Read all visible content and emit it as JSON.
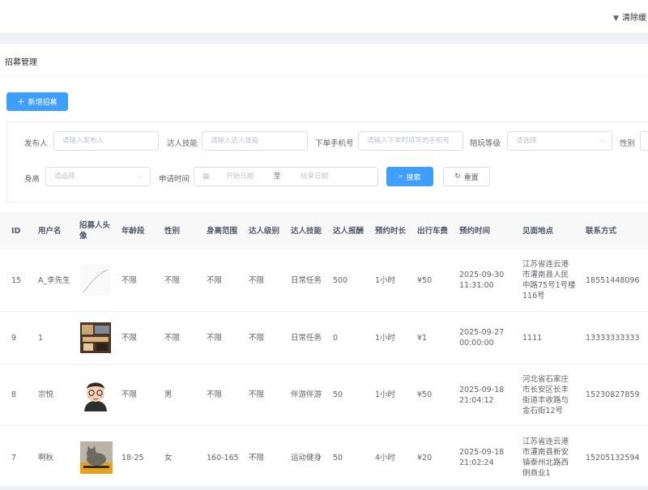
{
  "header": {
    "clear_label": "清除缓"
  },
  "page": {
    "title": "招募管理",
    "add_button": "新增招募"
  },
  "filters": {
    "publisher": {
      "label": "发布人",
      "placeholder": "请输入发布人"
    },
    "talent_skill": {
      "label": "达人技能",
      "placeholder": "请输入达人技能"
    },
    "phone": {
      "label": "下单手机号",
      "placeholder": "请输入下单时填写的手机号"
    },
    "play_level": {
      "label": "陪玩等级",
      "placeholder": "请选择"
    },
    "gender": {
      "label": "性别"
    },
    "height": {
      "label": "身高",
      "placeholder": "请选择"
    },
    "apply_time": {
      "label": "申请时间",
      "start": "开始日期",
      "sep": "至",
      "end": "结束日期"
    },
    "search_button": "搜索",
    "reset_button": "重置"
  },
  "table": {
    "headers": [
      "ID",
      "用户名",
      "招募人头像",
      "年龄段",
      "性别",
      "身高范围",
      "达人级别",
      "达人技能",
      "达人报酬",
      "预约时长",
      "出行车费",
      "预约时间",
      "见面地点",
      "联系方式"
    ],
    "rows": [
      {
        "id": "15",
        "username": "A_李先生",
        "avatar": "sketch",
        "age": "不限",
        "gender": "不限",
        "height": "不限",
        "level": "不限",
        "skill": "日常任务",
        "reward": "500",
        "duration": "1小时",
        "fare": "¥50",
        "time": "2025-09-30 11:31:00",
        "location": "江苏省连云港市灌南县人民中路75号1号楼116号",
        "contact": "18551448096"
      },
      {
        "id": "9",
        "username": "1",
        "avatar": "photo-dark",
        "age": "不限",
        "gender": "不限",
        "height": "不限",
        "level": "不限",
        "skill": "日常任务",
        "reward": "0",
        "duration": "1小时",
        "fare": "¥1",
        "time": "2025-09-27 00:00:00",
        "location": "1111",
        "contact": "13333333333"
      },
      {
        "id": "8",
        "username": "宗悦",
        "avatar": "cartoon-face",
        "age": "不限",
        "gender": "男",
        "height": "不限",
        "level": "不限",
        "skill": "伴游伴游",
        "reward": "50",
        "duration": "1小时",
        "fare": "¥50",
        "time": "2025-09-18 21:04:12",
        "location": "河北省石家庄市长安区长丰街道丰收路与金石街12号",
        "contact": "15230827859"
      },
      {
        "id": "7",
        "username": "啊秋",
        "avatar": "photo-cat",
        "age": "18-25",
        "gender": "女",
        "height": "160-165",
        "level": "不限",
        "skill": "运动健身",
        "reward": "50",
        "duration": "4小时",
        "fare": "¥20",
        "time": "2025-09-18 21:02:24",
        "location": "江苏省连云港市灌南县新安镇泰州北路西侧商业1",
        "contact": "15205132594"
      }
    ]
  }
}
